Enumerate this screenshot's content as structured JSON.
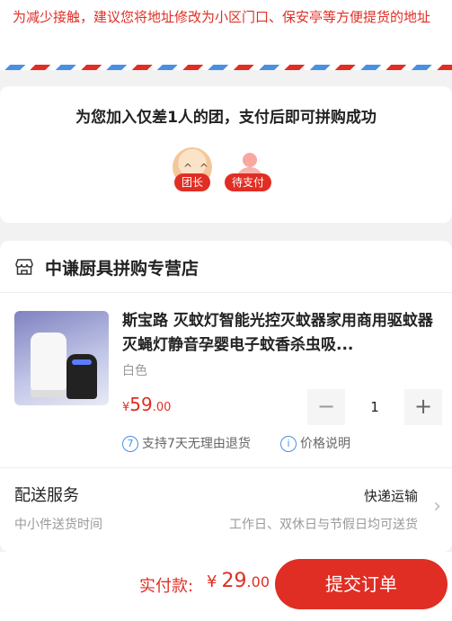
{
  "notice": {
    "text": "为减少接触，建议您将地址修改为小区门口、保安亭等方便提货的地址"
  },
  "group": {
    "title": "为您加入仅差1人的团，支付后即可拼购成功",
    "leader_tag": "团长",
    "waiting_tag": "待支付"
  },
  "shop": {
    "name": "中谦厨具拼购专营店"
  },
  "product": {
    "title": "斯宝路 灭蚊灯智能光控灭蚊器家用商用驱蚊器灭蝇灯静音孕婴电子蚊香杀虫吸...",
    "variant": "白色",
    "price_currency": "¥",
    "price_int": "59",
    "price_dec": ".00",
    "quantity": "1",
    "minus": "−",
    "plus": "+",
    "promise_return": "支持7天无理由退货",
    "promise_return_icon": "7",
    "promise_price": "价格说明",
    "promise_price_icon": "i"
  },
  "delivery": {
    "title": "配送服务",
    "subtitle": "中小件送货时间",
    "method": "快递运输",
    "desc": "工作日、双休日与节假日均可送货"
  },
  "footer": {
    "pay_label": "实付款:",
    "currency": "¥",
    "amount_int": "29",
    "amount_dec": ".00",
    "submit_label": "提交订单"
  },
  "colors": {
    "accent": "#e02e24",
    "info": "#4a90e2"
  },
  "icons": {
    "store": "store-icon",
    "chevron": "chevron-right-icon"
  }
}
